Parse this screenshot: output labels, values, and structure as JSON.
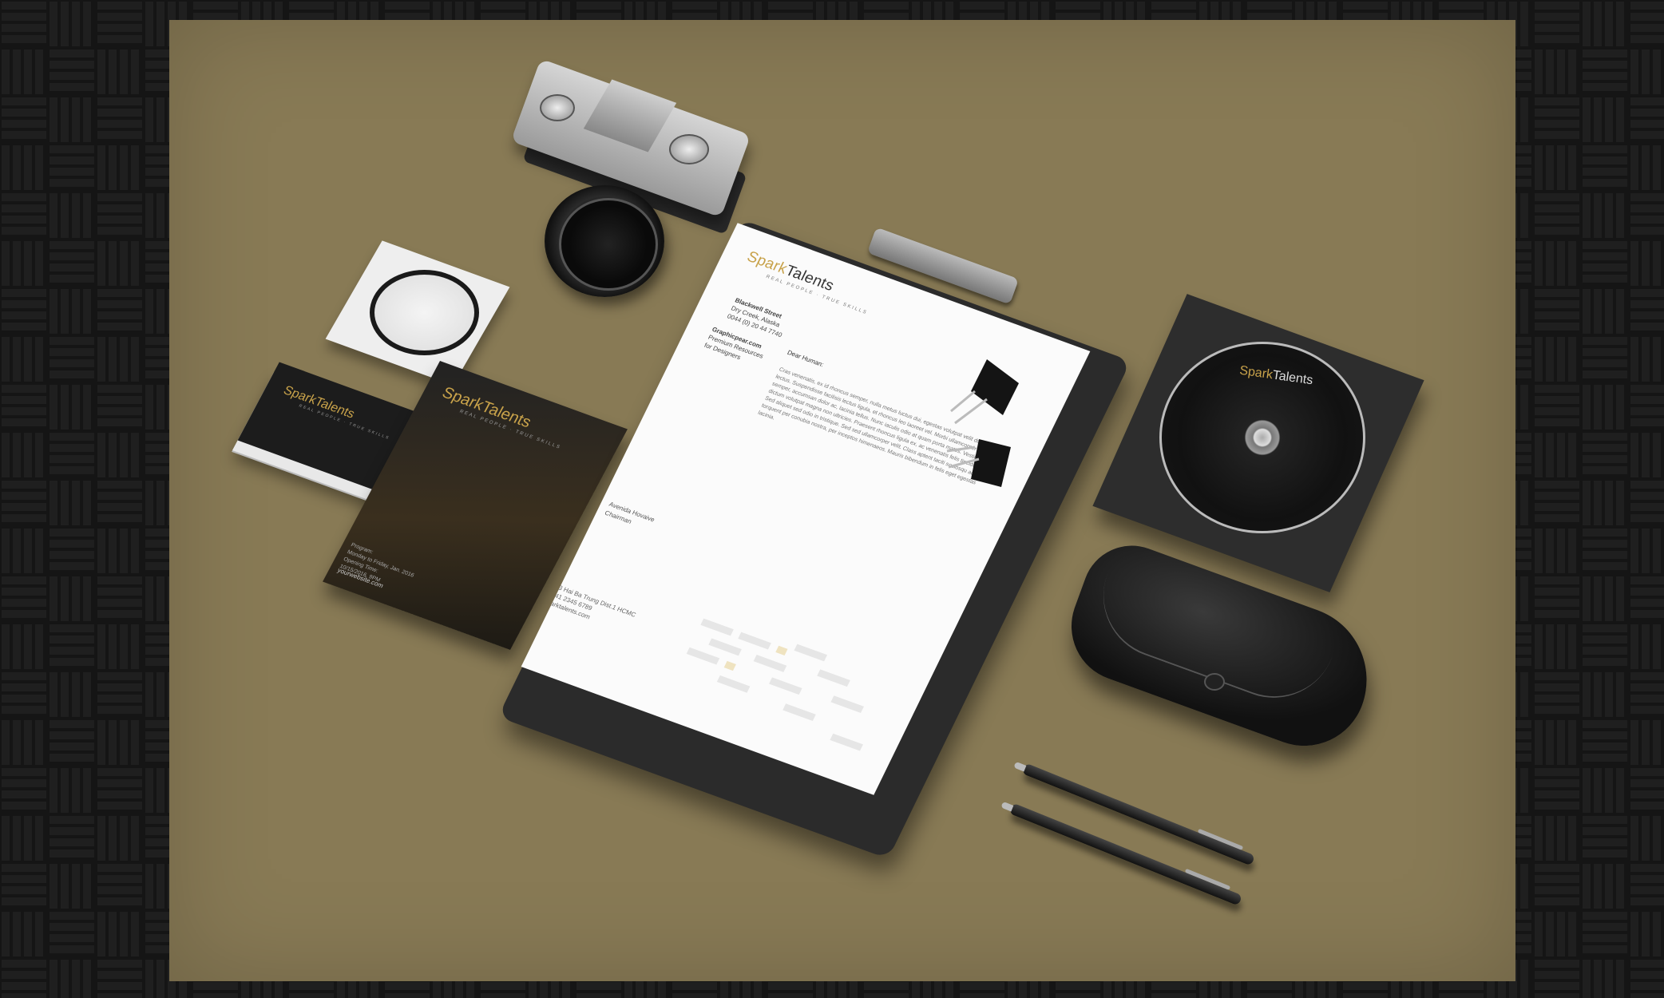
{
  "brand": {
    "name_part1": "Spark",
    "name_part2": "Talents",
    "tagline": "REAL PEOPLE · TRUE SKILLS",
    "accent_color": "#c8a24a"
  },
  "letterhead": {
    "address_block": [
      "Blackwell Street",
      "Dry Creek, Alaska",
      "0044 (0) 20 44 7740"
    ],
    "site_block": [
      "Graphicpear.com",
      "Premium Resources",
      "for Designers"
    ],
    "greeting": "Dear Human:",
    "body": "Cras venenatis, ex id rhoncus semper, nulla metus luctus dui, egestas volutpat velit dui nec lectus. Suspendisse facilisis lectus ligula, et rhoncus leo laoreet vel. Morbi ullamcorper urna semper, accumsan dolor ac, lacinia tellus. Nunc iaculis odio at quam porta mattis. Vestibulum dictum volutpat magna non ultricies. Praesent rhoncus ligula ex, ac venenatis felis tincidunt id. Sed aliquet sed odio in tristique. Sed sed ullamcorper velit. Class aptent taciti sociosqu ad litora torquent per conubia nostra, per inceptos himenaeos. Mauris bibendum in felis eget egestas lacinia.",
    "signature": [
      "Avenida Hovaive",
      "Chairman"
    ],
    "footer": [
      "123 Hai Ba Trung Dist.1 HCMC",
      "+841 2345 6789",
      "sparktalents.com"
    ]
  },
  "brochure": {
    "info": [
      "Program:",
      "Monday to Friday, Jan. 2016",
      "Opening Time:",
      "10/15/2016, 9PM"
    ],
    "website": "yourwebsite.com"
  },
  "colors": {
    "desk": "#887a55",
    "floor": "#141414"
  }
}
